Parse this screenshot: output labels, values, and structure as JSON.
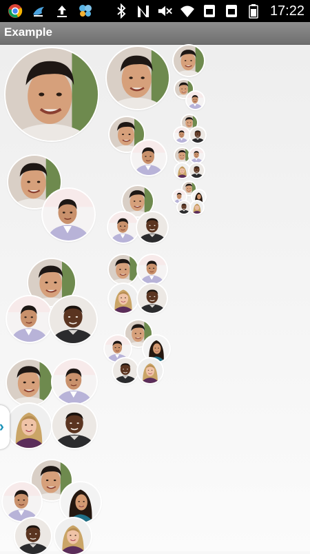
{
  "status_bar": {
    "time": "17:22",
    "icons_left": [
      "chrome-icon",
      "bird-icon",
      "upload-icon",
      "butterfly-icon"
    ],
    "icons_right": [
      "bluetooth-icon",
      "nfc-icon",
      "mute-icon",
      "wifi-icon",
      "sim1-icon",
      "sim2-icon",
      "battery-icon"
    ]
  },
  "action_bar": {
    "title": "Example"
  },
  "drawer_handle": {
    "icon": "chevron-right-icon"
  },
  "colors": {
    "status_bar_bg": "#000000",
    "action_bar_bg": "#777777",
    "accent": "#1b92b8"
  }
}
